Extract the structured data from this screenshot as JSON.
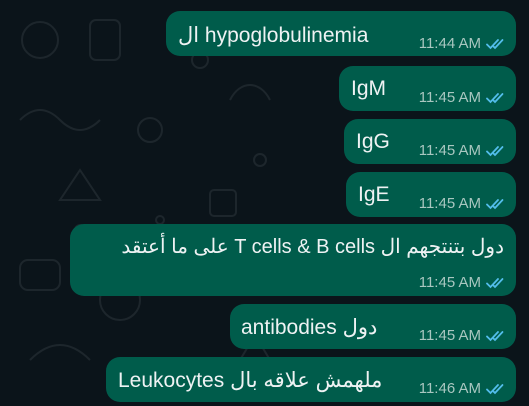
{
  "chat": {
    "messages": [
      {
        "text": "ال hypoglobulinemia",
        "time": "11:44 AM",
        "status": "read-double-tick-icon"
      },
      {
        "text": "IgM",
        "time": "11:45 AM",
        "status": "read-double-tick-icon"
      },
      {
        "text": "IgG",
        "time": "11:45 AM",
        "status": "read-double-tick-icon"
      },
      {
        "text": "IgE",
        "time": "11:45 AM",
        "status": "read-double-tick-icon"
      },
      {
        "text": "دول بتنتجهم ال T cells & B cells على ما أعتقد",
        "time": "11:45 AM",
        "status": "read-double-tick-icon"
      },
      {
        "text": "دول antibodies",
        "time": "11:45 AM",
        "status": "read-double-tick-icon"
      },
      {
        "text": "ملهمش علاقه بال Leukocytes",
        "time": "11:46 AM",
        "status": "read-double-tick-icon"
      }
    ]
  },
  "colors": {
    "background": "#0b141a",
    "outgoing_bubble": "#005c4b",
    "read_tick": "#53bdeb",
    "meta_text": "#a9c7c0"
  }
}
